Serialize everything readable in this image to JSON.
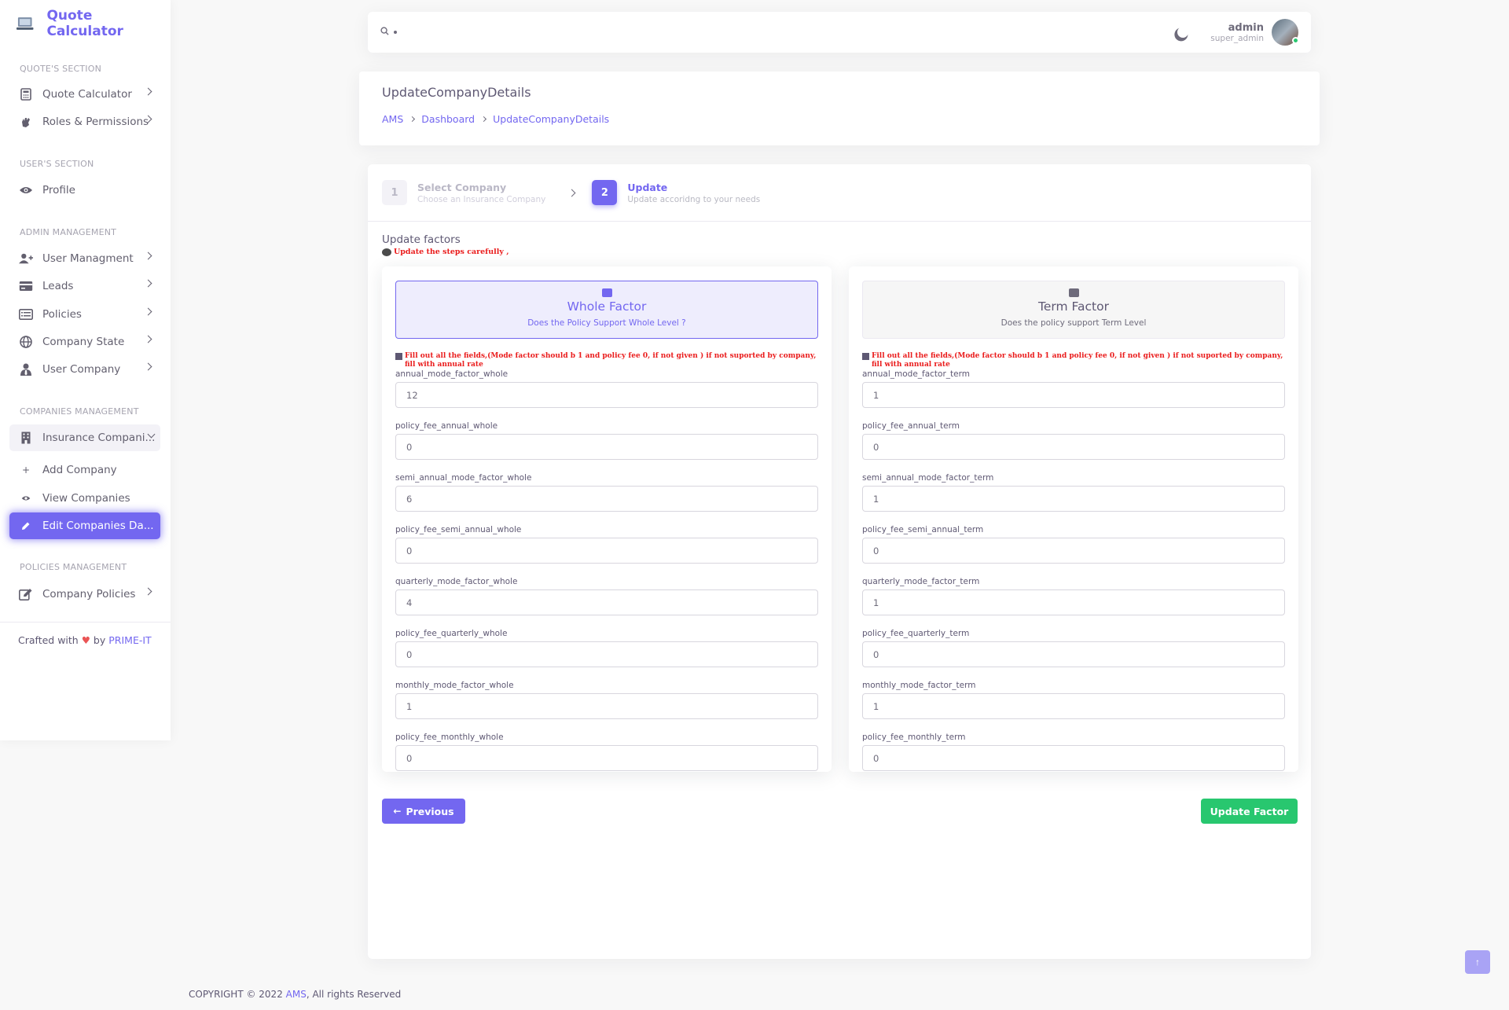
{
  "app": {
    "title": "Quote Calculator"
  },
  "sidebar": {
    "sections": {
      "quotes": "QUOTE'S SECTION",
      "users": "USER'S SECTION",
      "admin": "ADMIN MANAGEMENT",
      "companies": "COMPANIES MANAGEMENT",
      "policies": "POLICIES MANAGEMENT"
    },
    "items": {
      "quote_calculator": "Quote Calculator",
      "roles": "Roles & Permissions",
      "profile": "Profile",
      "user_management": "User Managment",
      "leads": "Leads",
      "policies": "Policies",
      "company_state": "Company State",
      "user_company": "User Company",
      "insurance_companies": "Insurance Compani...",
      "add_company": "Add Company",
      "view_companies": "View Companies",
      "edit_companies": "Edit Companies Da...",
      "company_policies": "Company Policies"
    },
    "crafted": {
      "prefix": "Crafted with",
      "by": "by",
      "brand": "PRIME-IT"
    }
  },
  "navbar": {
    "user_name": "admin",
    "user_role": "super_admin"
  },
  "header": {
    "title": "UpdateCompanyDetails",
    "breadcrumb": [
      "AMS",
      "Dashboard",
      "UpdateCompanyDetails"
    ]
  },
  "wizard": {
    "steps": [
      {
        "num": "1",
        "title": "Select Company",
        "sub": "Choose an Insurance Company"
      },
      {
        "num": "2",
        "title": "Update",
        "sub": "Update accoridng to your needs"
      }
    ],
    "update_title": "Update factors",
    "update_note": "Update the steps carefully ,",
    "warning": "Fill out all the fields,(Mode factor should b 1 and policy fee 0, if not given ) if not suported by company, fill with annual rate",
    "whole": {
      "title": "Whole Factor",
      "desc": "Does the Policy Support Whole Level ?",
      "fields": [
        {
          "label": "annual_mode_factor_whole",
          "value": "12"
        },
        {
          "label": "policy_fee_annual_whole",
          "value": "0"
        },
        {
          "label": "semi_annual_mode_factor_whole",
          "value": "6"
        },
        {
          "label": "policy_fee_semi_annual_whole",
          "value": "0"
        },
        {
          "label": "quarterly_mode_factor_whole",
          "value": "4"
        },
        {
          "label": "policy_fee_quarterly_whole",
          "value": "0"
        },
        {
          "label": "monthly_mode_factor_whole",
          "value": "1"
        },
        {
          "label": "policy_fee_monthly_whole",
          "value": "0"
        }
      ]
    },
    "term": {
      "title": "Term Factor",
      "desc": "Does the policy support Term Level",
      "fields": [
        {
          "label": "annual_mode_factor_term",
          "value": "1"
        },
        {
          "label": "policy_fee_annual_term",
          "value": "0"
        },
        {
          "label": "semi_annual_mode_factor_term",
          "value": "1"
        },
        {
          "label": "policy_fee_semi_annual_term",
          "value": "0"
        },
        {
          "label": "quarterly_mode_factor_term",
          "value": "1"
        },
        {
          "label": "policy_fee_quarterly_term",
          "value": "0"
        },
        {
          "label": "monthly_mode_factor_term",
          "value": "1"
        },
        {
          "label": "policy_fee_monthly_term",
          "value": "0"
        }
      ]
    },
    "prev_label": "Previous",
    "update_label": "Update Factor"
  },
  "footer": {
    "prefix": "COPYRIGHT © 2022",
    "brand": "AMS",
    "suffix": ", All rights Reserved"
  },
  "colors": {
    "primary": "#7367f0",
    "success": "#28c76f",
    "danger": "#ea1c1c"
  }
}
